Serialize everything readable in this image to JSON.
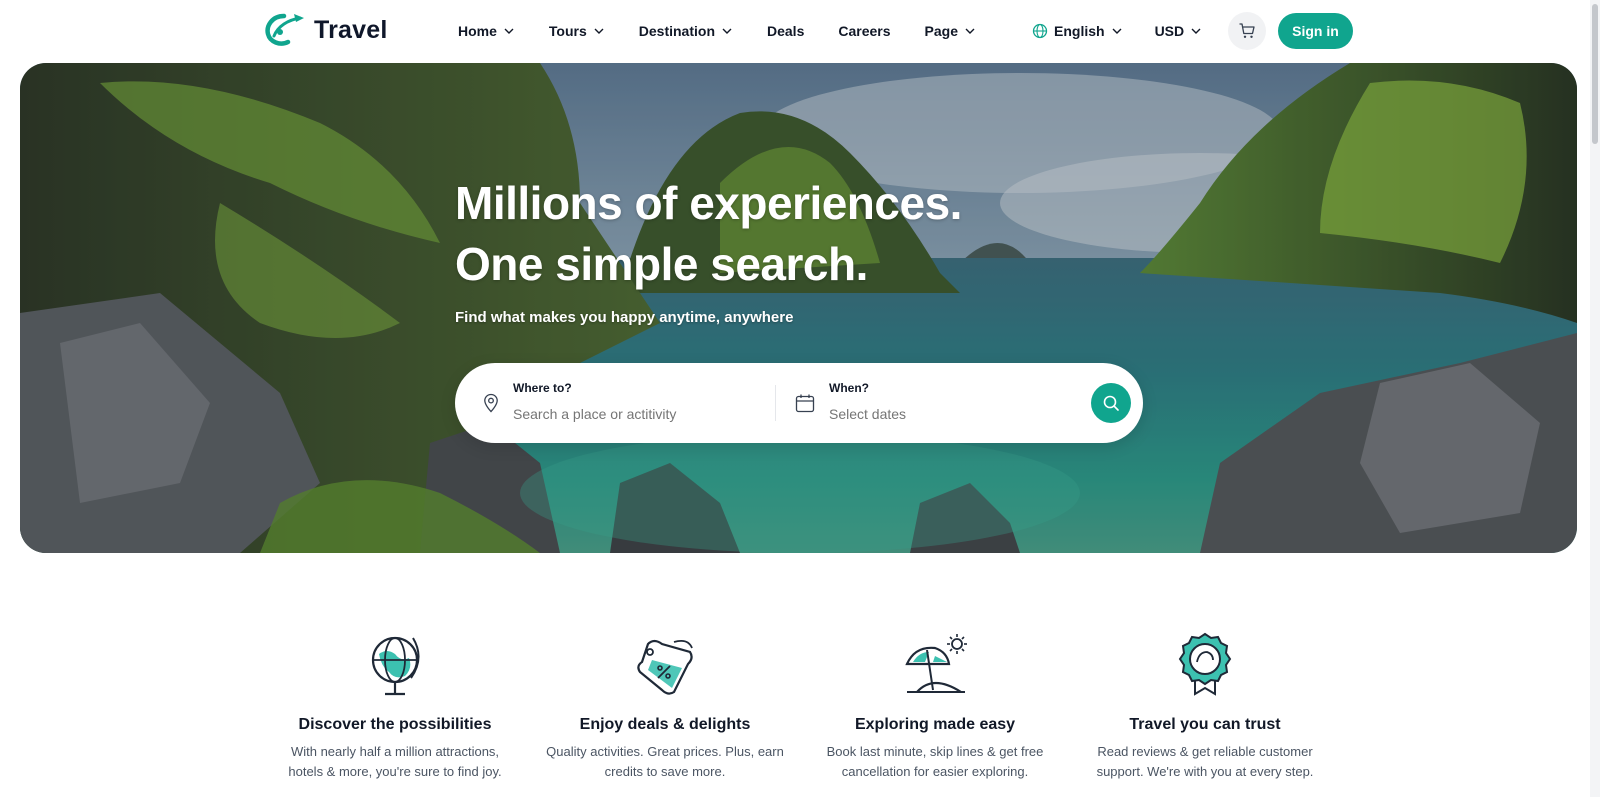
{
  "brand": {
    "name": "Travel",
    "accent": "#10a58e"
  },
  "nav": {
    "items": [
      {
        "label": "Home",
        "has_dropdown": true
      },
      {
        "label": "Tours",
        "has_dropdown": true
      },
      {
        "label": "Destination",
        "has_dropdown": true
      },
      {
        "label": "Deals",
        "has_dropdown": false
      },
      {
        "label": "Careers",
        "has_dropdown": false
      },
      {
        "label": "Page",
        "has_dropdown": true
      }
    ]
  },
  "header": {
    "language": "English",
    "currency": "USD",
    "cart_icon": "cart-icon",
    "signin_label": "Sign in"
  },
  "hero": {
    "title_line1": "Millions of experiences.",
    "title_line2": "One simple search.",
    "subtitle": "Find what makes you happy anytime, anywhere"
  },
  "search": {
    "where_label": "Where to?",
    "where_placeholder": "Search a place or actitivity",
    "when_label": "When?",
    "when_placeholder": "Select dates"
  },
  "features": [
    {
      "icon": "globe-icon",
      "title": "Discover the possibilities",
      "desc": "With nearly half a million attractions, hotels & more, you're sure to find joy."
    },
    {
      "icon": "discount-tag-icon",
      "title": "Enjoy deals & delights",
      "desc": "Quality activities. Great prices. Plus, earn credits to save more."
    },
    {
      "icon": "beach-umbrella-icon",
      "title": "Exploring made easy",
      "desc": "Book last minute, skip lines & get free cancellation for easier exploring."
    },
    {
      "icon": "award-badge-icon",
      "title": "Travel you can trust",
      "desc": "Read reviews & get reliable customer support. We're with you at every step."
    }
  ]
}
